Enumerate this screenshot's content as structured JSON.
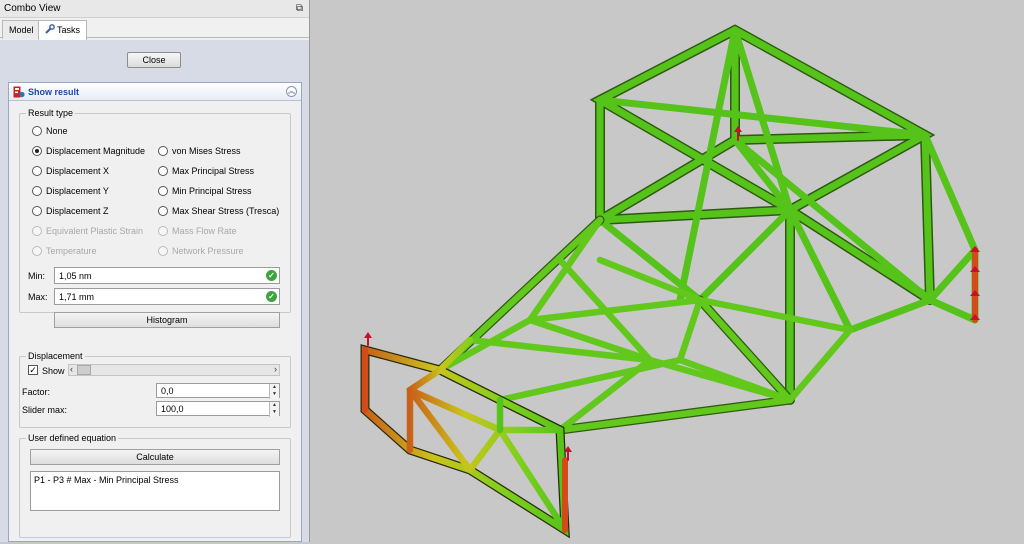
{
  "window": {
    "title": "Combo View"
  },
  "tabs": {
    "model": "Model",
    "tasks": "Tasks"
  },
  "close_label": "Close",
  "show_result": {
    "title": "Show result",
    "result_type": {
      "legend": "Result type",
      "none": "None",
      "disp_mag": "Displacement Magnitude",
      "disp_x": "Displacement X",
      "disp_y": "Displacement Y",
      "disp_z": "Displacement Z",
      "eq_plastic": "Equivalent Plastic Strain",
      "temperature": "Temperature",
      "von_mises": "von Mises Stress",
      "max_principal": "Max Principal Stress",
      "min_principal": "Min Principal Stress",
      "max_shear": "Max Shear Stress (Tresca)",
      "mass_flow": "Mass Flow Rate",
      "network_pressure": "Network Pressure",
      "selected": "Displacement Magnitude"
    },
    "min_label": "Min:",
    "min_value": "1,05 nm",
    "max_label": "Max:",
    "max_value": "1,71 mm",
    "histogram": "Histogram",
    "displacement": {
      "legend": "Displacement",
      "show": "Show",
      "factor_label": "Factor:",
      "factor_value": "0,0",
      "slider_max_label": "Slider max:",
      "slider_max_value": "100,0"
    },
    "equation": {
      "legend": "User defined equation",
      "calculate": "Calculate",
      "text": "P1 - P3 # Max - Min Principal Stress"
    }
  },
  "colors": {
    "background": "#c8c8c8",
    "beam_green": "#5fc91c",
    "beam_yellow": "#c3d21c",
    "beam_red": "#c23a12",
    "accent": "#1c4aa0"
  },
  "icons": {
    "dock": "dock-icon",
    "tasks": "wrench-icon",
    "fem": "fem-result-icon",
    "collapse": "collapse-icon",
    "valid": "check-icon"
  }
}
